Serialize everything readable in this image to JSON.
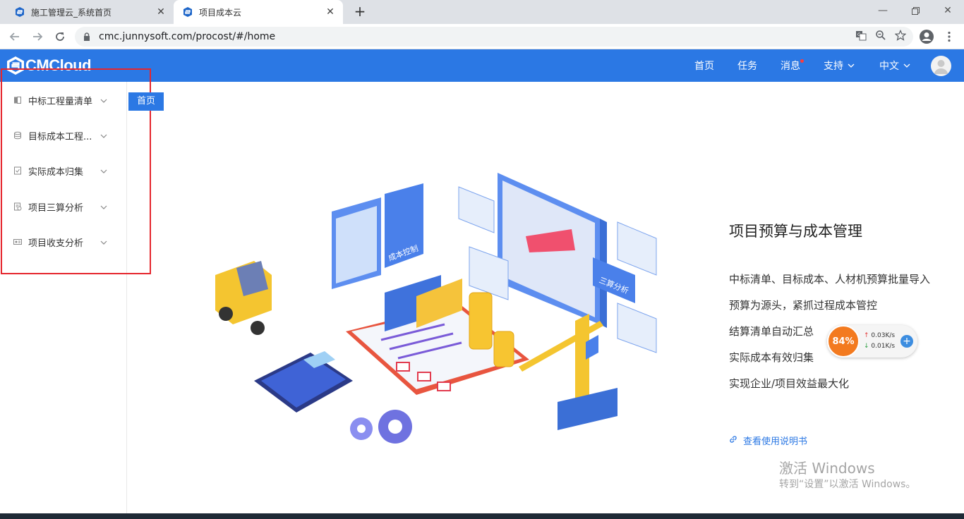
{
  "browser": {
    "tabs": [
      {
        "title": "施工管理云_系统首页",
        "active": false
      },
      {
        "title": "项目成本云",
        "active": true
      }
    ],
    "url": "cmc.junnysoft.com/procost/#/home"
  },
  "header": {
    "logo_text": "CMCloud",
    "nav": {
      "home": "首页",
      "tasks": "任务",
      "messages": "消息",
      "support": "支持",
      "language": "中文"
    },
    "brand_color": "#2b78e4",
    "badge_color": "#ff3b3b"
  },
  "sidebar": {
    "items": [
      {
        "label": "中标工程量清单",
        "icon": "book-icon"
      },
      {
        "label": "目标成本工程...",
        "icon": "database-icon"
      },
      {
        "label": "实际成本归集",
        "icon": "document-check-icon"
      },
      {
        "label": "项目三算分析",
        "icon": "analysis-icon"
      },
      {
        "label": "项目收支分析",
        "icon": "income-icon"
      }
    ]
  },
  "breadcrumb_tag": "首页",
  "hero": {
    "illustration_labels": {
      "cost_control": "成本控制",
      "three_calc": "三算分析"
    }
  },
  "intro": {
    "title": "项目预算与成本管理",
    "features": [
      "中标清单、目标成本、人材机预算批量导入",
      "预算为源头，紧抓过程成本管控",
      "结算清单自动汇总",
      "实际成本有效归集",
      "实现企业/项目效益最大化"
    ],
    "manual_link": "查看使用说明书"
  },
  "net_widget": {
    "percent": "84%",
    "upload": "0.03K/s",
    "download": "0.01K/s"
  },
  "watermark": {
    "line1": "激活 Windows",
    "line2": "转到“设置”以激活 Windows。"
  }
}
